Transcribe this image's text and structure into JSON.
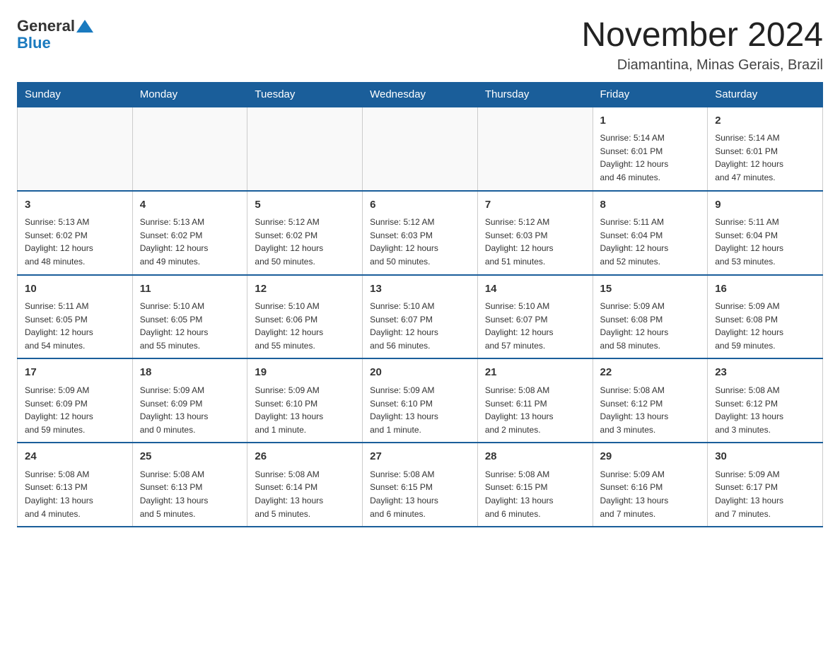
{
  "logo": {
    "text_general": "General",
    "text_blue": "Blue"
  },
  "title": "November 2024",
  "location": "Diamantina, Minas Gerais, Brazil",
  "weekdays": [
    "Sunday",
    "Monday",
    "Tuesday",
    "Wednesday",
    "Thursday",
    "Friday",
    "Saturday"
  ],
  "weeks": [
    [
      {
        "day": "",
        "info": ""
      },
      {
        "day": "",
        "info": ""
      },
      {
        "day": "",
        "info": ""
      },
      {
        "day": "",
        "info": ""
      },
      {
        "day": "",
        "info": ""
      },
      {
        "day": "1",
        "info": "Sunrise: 5:14 AM\nSunset: 6:01 PM\nDaylight: 12 hours\nand 46 minutes."
      },
      {
        "day": "2",
        "info": "Sunrise: 5:14 AM\nSunset: 6:01 PM\nDaylight: 12 hours\nand 47 minutes."
      }
    ],
    [
      {
        "day": "3",
        "info": "Sunrise: 5:13 AM\nSunset: 6:02 PM\nDaylight: 12 hours\nand 48 minutes."
      },
      {
        "day": "4",
        "info": "Sunrise: 5:13 AM\nSunset: 6:02 PM\nDaylight: 12 hours\nand 49 minutes."
      },
      {
        "day": "5",
        "info": "Sunrise: 5:12 AM\nSunset: 6:02 PM\nDaylight: 12 hours\nand 50 minutes."
      },
      {
        "day": "6",
        "info": "Sunrise: 5:12 AM\nSunset: 6:03 PM\nDaylight: 12 hours\nand 50 minutes."
      },
      {
        "day": "7",
        "info": "Sunrise: 5:12 AM\nSunset: 6:03 PM\nDaylight: 12 hours\nand 51 minutes."
      },
      {
        "day": "8",
        "info": "Sunrise: 5:11 AM\nSunset: 6:04 PM\nDaylight: 12 hours\nand 52 minutes."
      },
      {
        "day": "9",
        "info": "Sunrise: 5:11 AM\nSunset: 6:04 PM\nDaylight: 12 hours\nand 53 minutes."
      }
    ],
    [
      {
        "day": "10",
        "info": "Sunrise: 5:11 AM\nSunset: 6:05 PM\nDaylight: 12 hours\nand 54 minutes."
      },
      {
        "day": "11",
        "info": "Sunrise: 5:10 AM\nSunset: 6:05 PM\nDaylight: 12 hours\nand 55 minutes."
      },
      {
        "day": "12",
        "info": "Sunrise: 5:10 AM\nSunset: 6:06 PM\nDaylight: 12 hours\nand 55 minutes."
      },
      {
        "day": "13",
        "info": "Sunrise: 5:10 AM\nSunset: 6:07 PM\nDaylight: 12 hours\nand 56 minutes."
      },
      {
        "day": "14",
        "info": "Sunrise: 5:10 AM\nSunset: 6:07 PM\nDaylight: 12 hours\nand 57 minutes."
      },
      {
        "day": "15",
        "info": "Sunrise: 5:09 AM\nSunset: 6:08 PM\nDaylight: 12 hours\nand 58 minutes."
      },
      {
        "day": "16",
        "info": "Sunrise: 5:09 AM\nSunset: 6:08 PM\nDaylight: 12 hours\nand 59 minutes."
      }
    ],
    [
      {
        "day": "17",
        "info": "Sunrise: 5:09 AM\nSunset: 6:09 PM\nDaylight: 12 hours\nand 59 minutes."
      },
      {
        "day": "18",
        "info": "Sunrise: 5:09 AM\nSunset: 6:09 PM\nDaylight: 13 hours\nand 0 minutes."
      },
      {
        "day": "19",
        "info": "Sunrise: 5:09 AM\nSunset: 6:10 PM\nDaylight: 13 hours\nand 1 minute."
      },
      {
        "day": "20",
        "info": "Sunrise: 5:09 AM\nSunset: 6:10 PM\nDaylight: 13 hours\nand 1 minute."
      },
      {
        "day": "21",
        "info": "Sunrise: 5:08 AM\nSunset: 6:11 PM\nDaylight: 13 hours\nand 2 minutes."
      },
      {
        "day": "22",
        "info": "Sunrise: 5:08 AM\nSunset: 6:12 PM\nDaylight: 13 hours\nand 3 minutes."
      },
      {
        "day": "23",
        "info": "Sunrise: 5:08 AM\nSunset: 6:12 PM\nDaylight: 13 hours\nand 3 minutes."
      }
    ],
    [
      {
        "day": "24",
        "info": "Sunrise: 5:08 AM\nSunset: 6:13 PM\nDaylight: 13 hours\nand 4 minutes."
      },
      {
        "day": "25",
        "info": "Sunrise: 5:08 AM\nSunset: 6:13 PM\nDaylight: 13 hours\nand 5 minutes."
      },
      {
        "day": "26",
        "info": "Sunrise: 5:08 AM\nSunset: 6:14 PM\nDaylight: 13 hours\nand 5 minutes."
      },
      {
        "day": "27",
        "info": "Sunrise: 5:08 AM\nSunset: 6:15 PM\nDaylight: 13 hours\nand 6 minutes."
      },
      {
        "day": "28",
        "info": "Sunrise: 5:08 AM\nSunset: 6:15 PM\nDaylight: 13 hours\nand 6 minutes."
      },
      {
        "day": "29",
        "info": "Sunrise: 5:09 AM\nSunset: 6:16 PM\nDaylight: 13 hours\nand 7 minutes."
      },
      {
        "day": "30",
        "info": "Sunrise: 5:09 AM\nSunset: 6:17 PM\nDaylight: 13 hours\nand 7 minutes."
      }
    ]
  ]
}
